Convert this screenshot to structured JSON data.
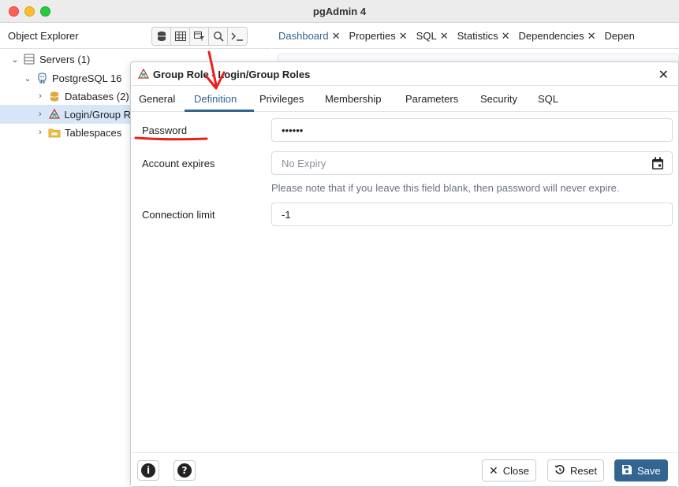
{
  "window": {
    "title": "pgAdmin 4"
  },
  "explorer": {
    "title": "Object Explorer",
    "tools": [
      "database-stack-icon",
      "table-grid-icon",
      "filter-table-icon",
      "search-icon",
      "terminal-icon"
    ],
    "tree": [
      {
        "label": "Servers (1)",
        "icon": "servers-icon",
        "expanded": true
      },
      {
        "label": "PostgreSQL 16",
        "icon": "postgres-elephant-icon",
        "expanded": true
      },
      {
        "label": "Databases (2)",
        "icon": "database-icon",
        "expanded": false
      },
      {
        "label": "Login/Group R",
        "icon": "group-role-icon",
        "expanded": false,
        "selected": true
      },
      {
        "label": "Tablespaces",
        "icon": "tablespaces-icon",
        "expanded": false
      }
    ]
  },
  "main_tabs": [
    {
      "label": "Dashboard",
      "close": "✕"
    },
    {
      "label": "Properties",
      "close": "✕"
    },
    {
      "label": "SQL",
      "close": "✕"
    },
    {
      "label": "Statistics",
      "close": "✕"
    },
    {
      "label": "Dependencies",
      "close": "✕"
    },
    {
      "label": "Depen",
      "close": ""
    }
  ],
  "dialog": {
    "title": "Group Role - Login/Group Roles",
    "close_glyph": "✕",
    "tabs": [
      "General",
      "Definition",
      "Privileges",
      "Membership",
      "Parameters",
      "Security",
      "SQL"
    ],
    "active_tab": "Definition",
    "fields": {
      "password_label": "Password",
      "password_value": "••••••",
      "expires_label": "Account expires",
      "expires_placeholder": "No Expiry",
      "expires_help": "Please note that if you leave this field blank, then password will never expire.",
      "conn_limit_label": "Connection limit",
      "conn_limit_value": "-1"
    },
    "footer": {
      "info_glyph": "i",
      "help_glyph": "?",
      "close_label": "Close",
      "reset_label": "Reset",
      "save_label": "Save"
    }
  },
  "colors": {
    "accent": "#326690",
    "annotation": "#e8211d",
    "selected_row": "#d6e6f7"
  }
}
